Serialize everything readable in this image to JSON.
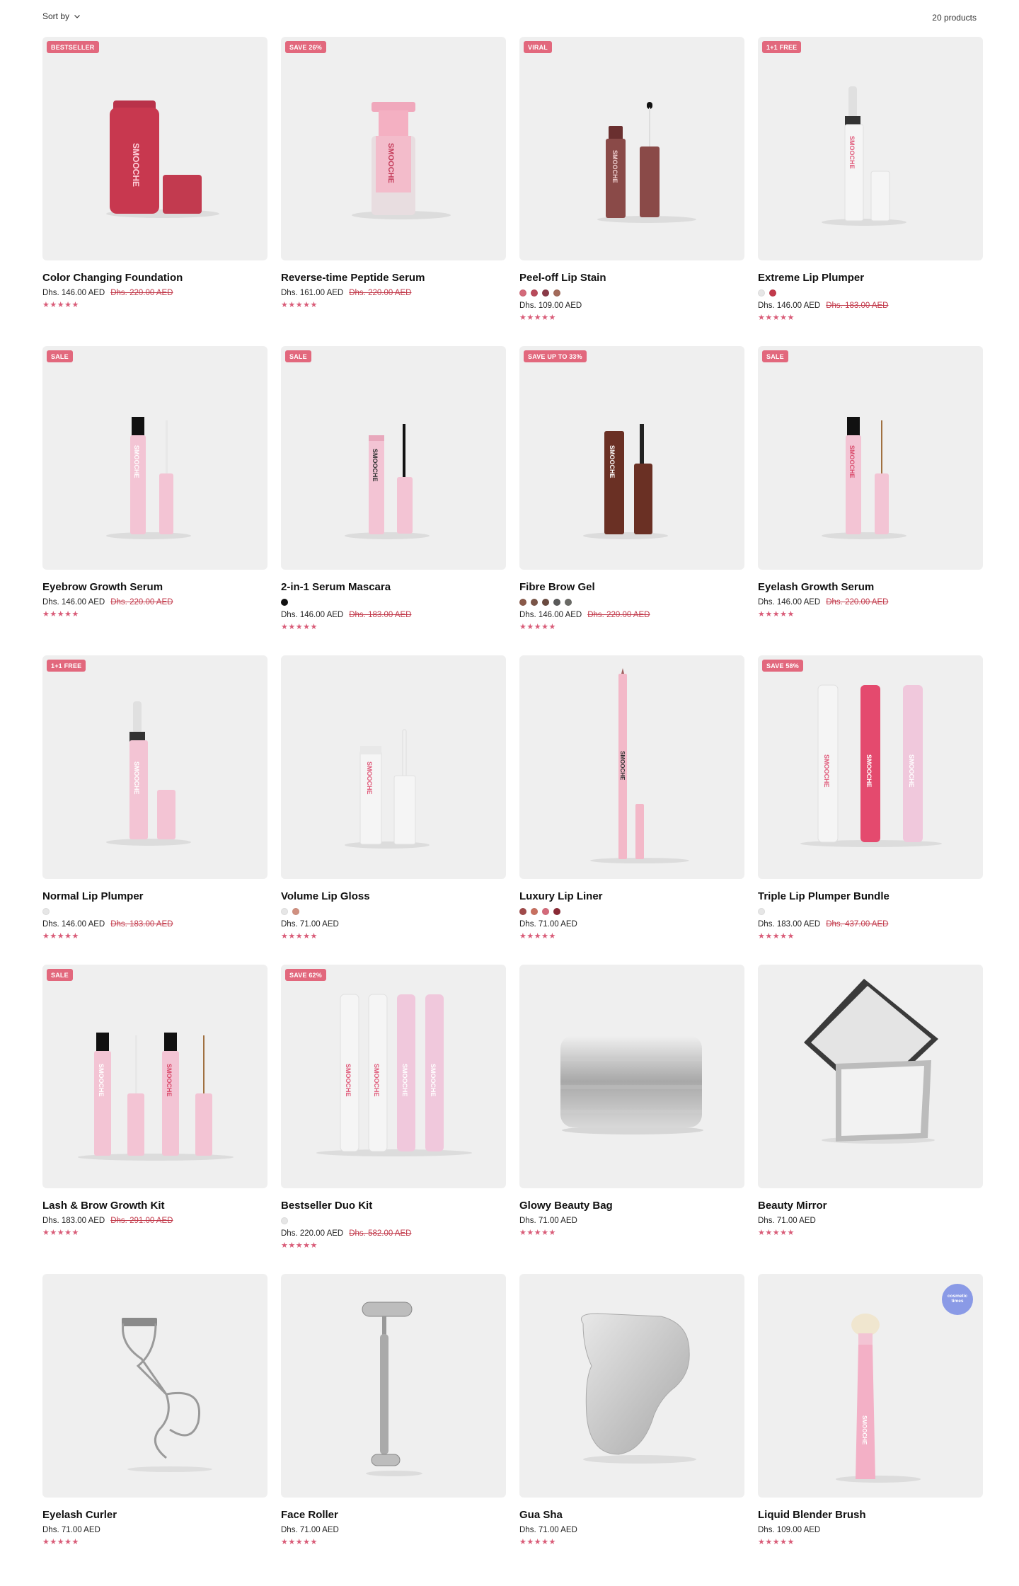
{
  "toolbar": {
    "sort_label": "Sort by",
    "product_count": "20 products"
  },
  "colors": {
    "badge": "#e2687d",
    "stars": "#d95c78",
    "compare_price": "#c23a4b",
    "media_bg": "#efefef"
  },
  "products": [
    {
      "title": "Color Changing Foundation",
      "badge": "BESTSELLER",
      "price": "Dhs. 146.00 AED",
      "compare": "Dhs. 220.00 AED",
      "swatches": [],
      "stars": "★★★★★",
      "art": "foundation"
    },
    {
      "title": "Reverse-time Peptide Serum",
      "badge": "SAVE 26%",
      "price": "Dhs. 161.00 AED",
      "compare": "Dhs. 220.00 AED",
      "swatches": [],
      "stars": "★★★★★",
      "art": "serum"
    },
    {
      "title": "Peel-off Lip Stain",
      "badge": "VIRAL",
      "price": "Dhs. 109.00 AED",
      "compare": "",
      "swatches": [
        "#d46a7a",
        "#b84a5a",
        "#8a3a48",
        "#a36a5a"
      ],
      "stars": "★★★★★",
      "art": "lipstain"
    },
    {
      "title": "Extreme Lip Plumper",
      "badge": "1+1 FREE",
      "price": "Dhs. 146.00 AED",
      "compare": "Dhs. 183.00 AED",
      "swatches": [
        "#e6e6e6",
        "#c23a4b"
      ],
      "stars": "★★★★★",
      "art": "plumper_white"
    },
    {
      "title": "Eyebrow Growth Serum",
      "badge": "SALE",
      "price": "Dhs. 146.00 AED",
      "compare": "Dhs. 220.00 AED",
      "swatches": [],
      "stars": "★★★★★",
      "art": "pink_wand"
    },
    {
      "title": "2-in-1 Serum Mascara",
      "badge": "SALE",
      "price": "Dhs. 146.00 AED",
      "compare": "Dhs. 183.00 AED",
      "swatches": [
        "#111111"
      ],
      "stars": "★★★★★",
      "art": "mascara"
    },
    {
      "title": "Fibre Brow Gel",
      "badge": "SAVE UP TO 33%",
      "price": "Dhs. 146.00 AED",
      "compare": "Dhs. 220.00 AED",
      "swatches": [
        "#8a5a4a",
        "#7a5548",
        "#6a4a40",
        "#5a5a5a",
        "#6a6a66"
      ],
      "stars": "★★★★★",
      "art": "browgel"
    },
    {
      "title": "Eyelash Growth Serum",
      "badge": "SALE",
      "price": "Dhs. 146.00 AED",
      "compare": "Dhs. 220.00 AED",
      "swatches": [],
      "stars": "★★★★★",
      "art": "pink_wand_brown"
    },
    {
      "title": "Normal Lip Plumper",
      "badge": "1+1 FREE",
      "price": "Dhs. 146.00 AED",
      "compare": "Dhs. 183.00 AED",
      "swatches": [
        "#e6e6e6"
      ],
      "stars": "★★★★★",
      "art": "plumper_pink"
    },
    {
      "title": "Volume Lip Gloss",
      "badge": "",
      "price": "Dhs. 71.00 AED",
      "compare": "",
      "swatches": [
        "#e6e6e6",
        "#d09080"
      ],
      "stars": "★★★★★",
      "art": "gloss"
    },
    {
      "title": "Luxury Lip Liner",
      "badge": "",
      "price": "Dhs. 71.00 AED",
      "compare": "",
      "swatches": [
        "#a04a4a",
        "#c87060",
        "#d46a7a",
        "#8a2a35"
      ],
      "stars": "★★★★★",
      "art": "liner"
    },
    {
      "title": "Triple Lip Plumper Bundle",
      "badge": "SAVE 58%",
      "price": "Dhs. 183.00 AED",
      "compare": "Dhs. 437.00 AED",
      "swatches": [
        "#e6e6e6"
      ],
      "stars": "★★★★★",
      "art": "triple"
    },
    {
      "title": "Lash & Brow Growth Kit",
      "badge": "SALE",
      "price": "Dhs. 183.00 AED",
      "compare": "Dhs. 291.00 AED",
      "swatches": [],
      "stars": "★★★★★",
      "art": "lashbrow"
    },
    {
      "title": "Bestseller Duo Kit",
      "badge": "SAVE 62%",
      "price": "Dhs. 220.00 AED",
      "compare": "Dhs. 582.00 AED",
      "swatches": [
        "#e6e6e6"
      ],
      "stars": "★★★★★",
      "art": "duo"
    },
    {
      "title": "Glowy Beauty Bag",
      "badge": "",
      "price": "Dhs. 71.00 AED",
      "compare": "",
      "swatches": [],
      "stars": "★★★★★",
      "art": "bag"
    },
    {
      "title": "Beauty Mirror",
      "badge": "",
      "price": "Dhs. 71.00 AED",
      "compare": "",
      "swatches": [],
      "stars": "★★★★★",
      "art": "mirror"
    },
    {
      "title": "Eyelash Curler",
      "badge": "",
      "price": "Dhs. 71.00 AED",
      "compare": "",
      "swatches": [],
      "stars": "★★★★★",
      "art": "curler"
    },
    {
      "title": "Face Roller",
      "badge": "",
      "price": "Dhs. 71.00 AED",
      "compare": "",
      "swatches": [],
      "stars": "★★★★★",
      "art": "roller"
    },
    {
      "title": "Gua Sha",
      "badge": "",
      "price": "Dhs. 71.00 AED",
      "compare": "",
      "swatches": [],
      "stars": "★★★★★",
      "art": "guasha"
    },
    {
      "title": "Liquid Blender Brush",
      "badge": "",
      "price": "Dhs. 109.00 AED",
      "compare": "",
      "swatches": [],
      "stars": "★★★★★",
      "art": "brush",
      "seal_text": "cosmetic times"
    }
  ]
}
